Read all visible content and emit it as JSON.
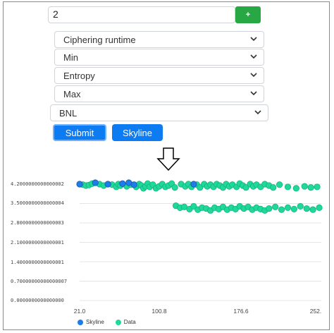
{
  "form": {
    "count_value": "2",
    "add_label": "+",
    "selects": [
      {
        "value": "Ciphering runtime"
      },
      {
        "value": "Min"
      },
      {
        "value": "Entropy"
      },
      {
        "value": "Max"
      },
      {
        "value": "BNL"
      }
    ],
    "submit_label": "Submit",
    "skyline_label": "Skyline"
  },
  "colors": {
    "add": "#28a745",
    "primary": "#0d7cf2",
    "skyline": "#1e7de8",
    "data": "#1ed99a"
  },
  "chart_data": {
    "type": "scatter",
    "y_ticks": [
      "4.2000000000000002",
      "3.5000000000000004",
      "2.8000000000000003",
      "2.1000000000000001",
      "1.4000000000000001",
      "0.70000000000000007",
      "0.0000000000000000"
    ],
    "x_ticks": [
      "21.0",
      "100.8",
      "176.6",
      "252."
    ],
    "xlim": [
      21.0,
      252.0
    ],
    "ylim": [
      0,
      4.2
    ],
    "legend": [
      "Skyline",
      "Data"
    ],
    "legend_placement": "bottom-left",
    "grid": true,
    "series": [
      {
        "name": "Skyline",
        "points": [
          [
            21,
            4.2
          ],
          [
            36,
            4.25
          ],
          [
            48,
            4.2
          ],
          [
            62,
            4.22
          ],
          [
            68,
            4.25
          ],
          [
            73,
            4.18
          ],
          [
            130,
            4.2
          ]
        ]
      },
      {
        "name": "Data",
        "points": [
          [
            24,
            4.18
          ],
          [
            27,
            4.15
          ],
          [
            30,
            4.17
          ],
          [
            33,
            4.22
          ],
          [
            40,
            4.2
          ],
          [
            44,
            4.15
          ],
          [
            52,
            4.18
          ],
          [
            56,
            4.1
          ],
          [
            58,
            4.2
          ],
          [
            60,
            4.15
          ],
          [
            66,
            4.12
          ],
          [
            70,
            4.18
          ],
          [
            75,
            4.1
          ],
          [
            78,
            4.2
          ],
          [
            80,
            4.15
          ],
          [
            82,
            4.05
          ],
          [
            84,
            4.12
          ],
          [
            86,
            4.22
          ],
          [
            88,
            4.1
          ],
          [
            91,
            4.18
          ],
          [
            94,
            4.05
          ],
          [
            97,
            4.12
          ],
          [
            100,
            4.2
          ],
          [
            103,
            4.1
          ],
          [
            106,
            4.15
          ],
          [
            109,
            4.22
          ],
          [
            112,
            4.08
          ],
          [
            118,
            4.2
          ],
          [
            122,
            4.12
          ],
          [
            125,
            4.2
          ],
          [
            128,
            4.1
          ],
          [
            133,
            4.18
          ],
          [
            136,
            4.08
          ],
          [
            140,
            4.2
          ],
          [
            143,
            4.12
          ],
          [
            146,
            4.18
          ],
          [
            149,
            4.1
          ],
          [
            152,
            4.2
          ],
          [
            155,
            4.15
          ],
          [
            158,
            4.08
          ],
          [
            161,
            4.2
          ],
          [
            164,
            4.12
          ],
          [
            167,
            4.18
          ],
          [
            171,
            4.1
          ],
          [
            174,
            4.22
          ],
          [
            177,
            4.15
          ],
          [
            180,
            4.08
          ],
          [
            184,
            4.2
          ],
          [
            187,
            4.12
          ],
          [
            190,
            4.18
          ],
          [
            194,
            4.1
          ],
          [
            198,
            4.2
          ],
          [
            202,
            4.15
          ],
          [
            206,
            4.08
          ],
          [
            212,
            4.18
          ],
          [
            220,
            4.1
          ],
          [
            228,
            4.05
          ],
          [
            236,
            4.12
          ],
          [
            242,
            4.08
          ],
          [
            248,
            4.1
          ],
          [
            113,
            3.42
          ],
          [
            117,
            3.35
          ],
          [
            121,
            3.38
          ],
          [
            126,
            3.3
          ],
          [
            130,
            3.4
          ],
          [
            134,
            3.28
          ],
          [
            138,
            3.35
          ],
          [
            142,
            3.32
          ],
          [
            146,
            3.25
          ],
          [
            150,
            3.35
          ],
          [
            154,
            3.3
          ],
          [
            158,
            3.38
          ],
          [
            162,
            3.28
          ],
          [
            166,
            3.35
          ],
          [
            170,
            3.3
          ],
          [
            174,
            3.4
          ],
          [
            178,
            3.32
          ],
          [
            182,
            3.38
          ],
          [
            186,
            3.28
          ],
          [
            190,
            3.35
          ],
          [
            194,
            3.3
          ],
          [
            198,
            3.25
          ],
          [
            202,
            3.32
          ],
          [
            208,
            3.38
          ],
          [
            214,
            3.28
          ],
          [
            220,
            3.35
          ],
          [
            226,
            3.3
          ],
          [
            232,
            3.4
          ],
          [
            238,
            3.32
          ],
          [
            244,
            3.28
          ],
          [
            250,
            3.35
          ]
        ]
      }
    ]
  }
}
